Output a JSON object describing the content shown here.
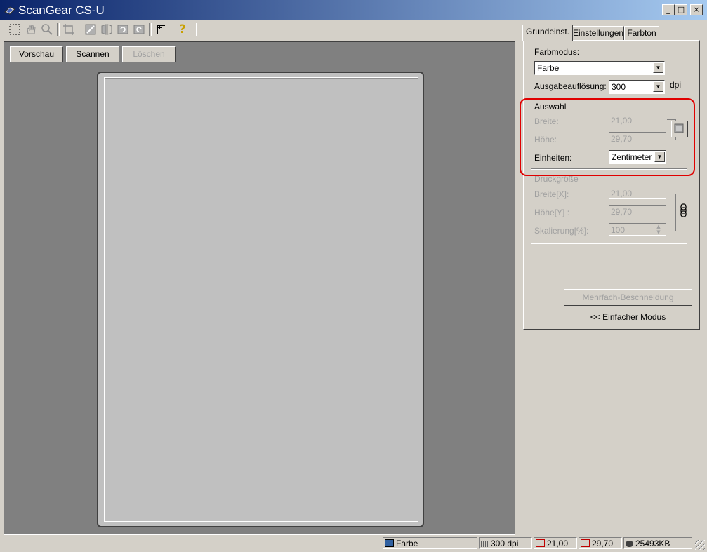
{
  "window": {
    "title": "ScanGear CS-U",
    "controls": {
      "minimize": "_",
      "maximize": "□",
      "close": "×"
    }
  },
  "toolbar": {
    "tools": [
      "select-tool-icon",
      "hand-icon",
      "zoom-icon",
      "crop-icon",
      "auto-crop-icon",
      "mirror-icon",
      "rotate-left-icon",
      "rotate-right-icon",
      "settings-icon",
      "help-icon"
    ],
    "help": "?"
  },
  "preview": {
    "preview_button": "Vorschau",
    "scan_button": "Scannen",
    "clear_button": "Löschen"
  },
  "tabs": [
    "Grundeinst.",
    "Einstellungen",
    "Farbton"
  ],
  "basic": {
    "color_mode_label": "Farbmodus:",
    "color_mode_value": "Farbe",
    "resolution_label": "Ausgabeauflösung:",
    "resolution_value": "300",
    "resolution_unit": "dpi",
    "selection": {
      "heading": "Auswahl",
      "width_label": "Breite:",
      "width_value": "21,00",
      "height_label": "Höhe:",
      "height_value": "29,70",
      "units_label": "Einheiten:",
      "units_value": "Zentimeter"
    },
    "print_size": {
      "heading": "Druckgröße",
      "width_label": "Breite[X]:",
      "width_value": "21,00",
      "height_label": "Höhe[Y] :",
      "height_value": "29,70",
      "scale_label": "Skalierung[%]:",
      "scale_value": "100"
    },
    "multi_crop_button": "Mehrfach-Beschneidung",
    "simple_mode_button": "<< Einfacher Modus"
  },
  "status_bar": {
    "color": "Farbe",
    "resolution": "300 dpi",
    "width": "21,00",
    "height": "29,70",
    "size": "25493KB"
  },
  "colors": {
    "highlight": "#e00000",
    "titlebar_start": "#0a246a",
    "titlebar_end": "#a6caf0"
  }
}
